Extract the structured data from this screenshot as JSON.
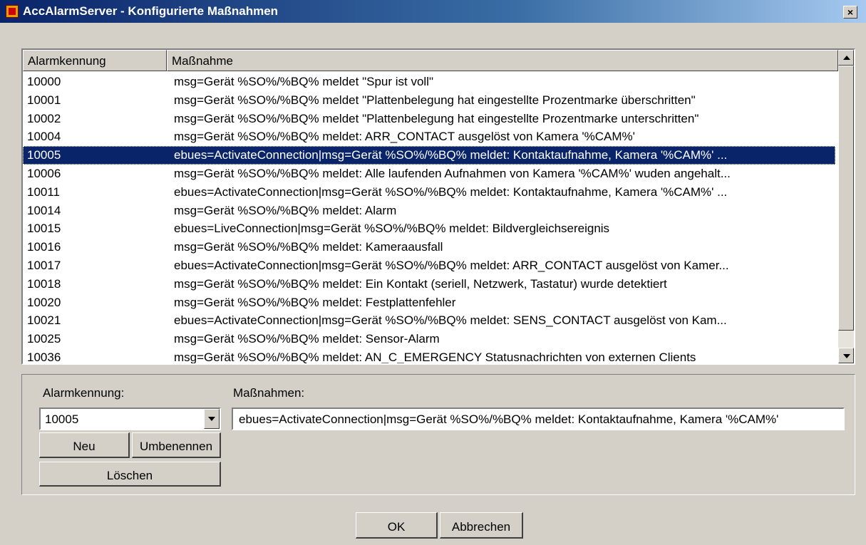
{
  "window": {
    "title": "AccAlarmServer - Konfigurierte Maßnahmen",
    "close_label": "×"
  },
  "list": {
    "columns": [
      "Alarmkennung",
      "Maßnahme"
    ],
    "rows": [
      {
        "id": "10000",
        "action": "msg=Gerät %SO%/%BQ% meldet \"Spur ist voll\""
      },
      {
        "id": "10001",
        "action": "msg=Gerät %SO%/%BQ% meldet \"Plattenbelegung hat eingestellte Prozentmarke überschritten\""
      },
      {
        "id": "10002",
        "action": "msg=Gerät %SO%/%BQ% meldet \"Plattenbelegung hat eingestellte Prozentmarke unterschritten\""
      },
      {
        "id": "10004",
        "action": "msg=Gerät %SO%/%BQ% meldet: ARR_CONTACT ausgelöst von Kamera '%CAM%'"
      },
      {
        "id": "10005",
        "action": "ebues=ActivateConnection|msg=Gerät %SO%/%BQ% meldet: Kontaktaufnahme, Kamera '%CAM%' ..."
      },
      {
        "id": "10006",
        "action": "msg=Gerät %SO%/%BQ% meldet: Alle laufenden Aufnahmen von Kamera '%CAM%' wuden angehalt..."
      },
      {
        "id": "10011",
        "action": "ebues=ActivateConnection|msg=Gerät %SO%/%BQ% meldet: Kontaktaufnahme, Kamera '%CAM%' ..."
      },
      {
        "id": "10014",
        "action": "msg=Gerät %SO%/%BQ% meldet: Alarm"
      },
      {
        "id": "10015",
        "action": "ebues=LiveConnection|msg=Gerät %SO%/%BQ% meldet: Bildvergleichsereignis"
      },
      {
        "id": "10016",
        "action": "msg=Gerät %SO%/%BQ% meldet: Kameraausfall"
      },
      {
        "id": "10017",
        "action": "ebues=ActivateConnection|msg=Gerät %SO%/%BQ% meldet: ARR_CONTACT ausgelöst von Kamer..."
      },
      {
        "id": "10018",
        "action": "msg=Gerät %SO%/%BQ% meldet: Ein Kontakt (seriell, Netzwerk, Tastatur) wurde detektiert"
      },
      {
        "id": "10020",
        "action": "msg=Gerät %SO%/%BQ% meldet: Festplattenfehler"
      },
      {
        "id": "10021",
        "action": "ebues=ActivateConnection|msg=Gerät %SO%/%BQ% meldet: SENS_CONTACT ausgelöst von Kam..."
      },
      {
        "id": "10025",
        "action": "msg=Gerät %SO%/%BQ% meldet: Sensor-Alarm"
      },
      {
        "id": "10036",
        "action": "msg=Gerät %SO%/%BQ% meldet: AN_C_EMERGENCY Statusnachrichten von externen Clients"
      }
    ],
    "selected_id": "10005"
  },
  "edit": {
    "id_label": "Alarmkennung:",
    "id_value": "10005",
    "actions_label": "Maßnahmen:",
    "actions_value": "ebues=ActivateConnection|msg=Gerät %SO%/%BQ% meldet: Kontaktaufnahme, Kamera '%CAM%'",
    "new_label": "Neu",
    "rename_label": "Umbenennen",
    "delete_label": "Löschen"
  },
  "footer": {
    "ok_label": "OK",
    "cancel_label": "Abbrechen"
  }
}
